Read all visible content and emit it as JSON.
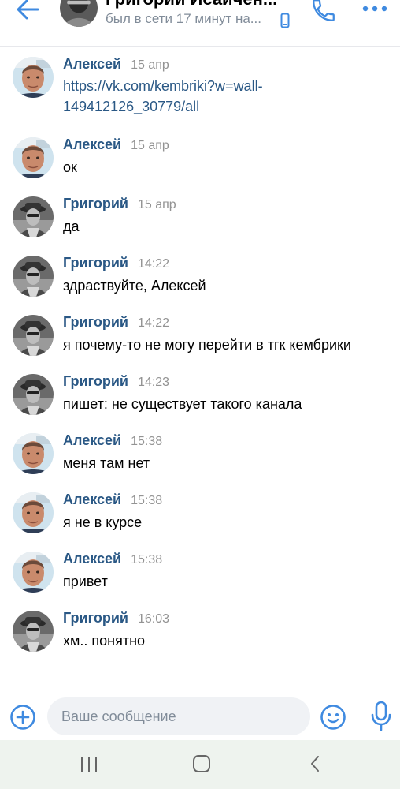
{
  "header": {
    "name": "Григорий Исайчен...",
    "status": "был в сети 17 минут на..."
  },
  "messages": [
    {
      "author": "Алексей",
      "time": "15 апр",
      "text": "https://vk.com/kembriki?w=wall-149412126_30779/all",
      "is_link": true
    },
    {
      "author": "Алексей",
      "time": "15 апр",
      "text": "ок"
    },
    {
      "author": "Григорий",
      "time": "15 апр",
      "text": "да"
    },
    {
      "author": "Григорий",
      "time": "14:22",
      "text": "здраствуйте, Алексей"
    },
    {
      "author": "Григорий",
      "time": "14:22",
      "text": "я почему-то не могу перейти в тгк кембрики"
    },
    {
      "author": "Григорий",
      "time": "14:23",
      "text": "пишет: не существует такого канала"
    },
    {
      "author": "Алексей",
      "time": "15:38",
      "text": "меня там нет"
    },
    {
      "author": "Алексей",
      "time": "15:38",
      "text": "я не в курсе"
    },
    {
      "author": "Алексей",
      "time": "15:38",
      "text": "привет"
    },
    {
      "author": "Григорий",
      "time": "16:03",
      "text": "хм.. понятно"
    }
  ],
  "composer": {
    "placeholder": "Ваше сообщение"
  },
  "colors": {
    "accent": "#2a5885",
    "icon_blue": "#3f8ae0",
    "secondary": "#818c99",
    "navbar_bg": "#eef3ee"
  },
  "icons": {
    "back": "arrow-left-icon",
    "mobile": "mobile-phone-icon",
    "call": "phone-icon",
    "more": "more-dots-icon",
    "attach": "plus-circle-icon",
    "emoji": "smile-icon",
    "mic": "microphone-icon"
  }
}
